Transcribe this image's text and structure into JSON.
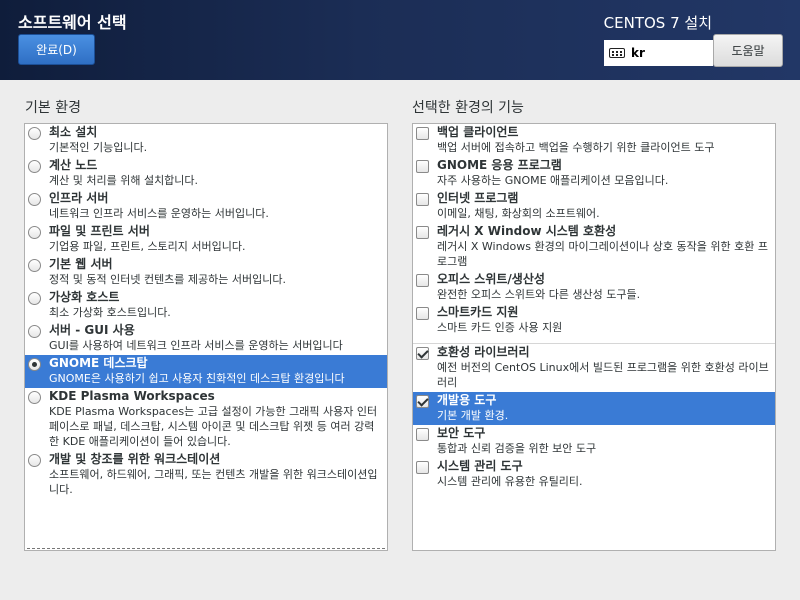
{
  "header": {
    "title": "소프트웨어 선택",
    "done_label": "완료(D)",
    "product": "CENTOS 7 설치",
    "keyboard_layout": "kr",
    "help_label": "도움말"
  },
  "left": {
    "title": "기본 환경",
    "items": [
      {
        "name": "최소 설치",
        "desc": "기본적인 기능입니다.",
        "selected": false
      },
      {
        "name": "계산 노드",
        "desc": "계산 및 처리를 위해 설치합니다.",
        "selected": false
      },
      {
        "name": "인프라 서버",
        "desc": "네트워크 인프라 서비스를 운영하는 서버입니다.",
        "selected": false
      },
      {
        "name": "파일 및 프린트 서버",
        "desc": "기업용 파일, 프린트, 스토리지 서버입니다.",
        "selected": false
      },
      {
        "name": "기본 웹 서버",
        "desc": "정적 및 동적 인터넷 컨텐츠를 제공하는 서버입니다.",
        "selected": false
      },
      {
        "name": "가상화 호스트",
        "desc": "최소 가상화 호스트입니다.",
        "selected": false
      },
      {
        "name": "서버 - GUI 사용",
        "desc": "GUI를 사용하여 네트워크 인프라 서비스를 운영하는 서버입니다",
        "selected": false
      },
      {
        "name": "GNOME 데스크탑",
        "desc": "GNOME은 사용하기 쉽고 사용자 친화적인 데스크탑 환경입니다",
        "selected": true
      },
      {
        "name": "KDE Plasma Workspaces",
        "desc": "KDE Plasma Workspaces는 고급 설정이 가능한 그래픽 사용자 인터페이스로 패널, 데스크탑, 시스템 아이콘 및 데스크탑 위젯 등 여러 강력한 KDE 애플리케이션이 들어 있습니다.",
        "selected": false
      },
      {
        "name": "개발 및 창조를 위한 워크스테이션",
        "desc": "소프트웨어, 하드웨어, 그래픽, 또는 컨텐츠 개발을 위한 워크스테이션입니다.",
        "selected": false
      }
    ]
  },
  "right": {
    "title": "선택한 환경의 기능",
    "items": [
      {
        "name": "백업 클라이언트",
        "desc": "백업 서버에 접속하고 백업을 수행하기 위한 클라이언트 도구",
        "checked": false,
        "selected": false,
        "separator": false
      },
      {
        "name": "GNOME 응용 프로그램",
        "desc": "자주 사용하는 GNOME 애플리케이션 모음입니다.",
        "checked": false,
        "selected": false,
        "separator": false
      },
      {
        "name": "인터넷 프로그램",
        "desc": "이메일, 채팅, 화상회의 소프트웨어.",
        "checked": false,
        "selected": false,
        "separator": false
      },
      {
        "name": "레거시 X Window 시스템 호환성",
        "desc": "레거시 X Windows 환경의 마이그레이션이나 상호 동작을 위한 호환 프로그램",
        "checked": false,
        "selected": false,
        "separator": false
      },
      {
        "name": "오피스 스위트/생산성",
        "desc": "완전한 오피스 스위트와 다른 생산성 도구들.",
        "checked": false,
        "selected": false,
        "separator": false
      },
      {
        "name": "스마트카드 지원",
        "desc": "스마트 카드 인증 사용 지원",
        "checked": false,
        "selected": false,
        "separator": false
      },
      {
        "name": "호환성 라이브러리",
        "desc": "예전 버전의 CentOS Linux에서 빌드된 프로그램을 위한 호환성 라이브러리",
        "checked": true,
        "selected": false,
        "separator": true
      },
      {
        "name": "개발용 도구",
        "desc": "기본 개발 환경.",
        "checked": true,
        "selected": true,
        "separator": false
      },
      {
        "name": "보안 도구",
        "desc": "통합과 신뢰 검증을 위한 보안 도구",
        "checked": false,
        "selected": false,
        "separator": false
      },
      {
        "name": "시스템 관리 도구",
        "desc": "시스템 관리에 유용한 유틸리티.",
        "checked": false,
        "selected": false,
        "separator": false
      }
    ]
  }
}
